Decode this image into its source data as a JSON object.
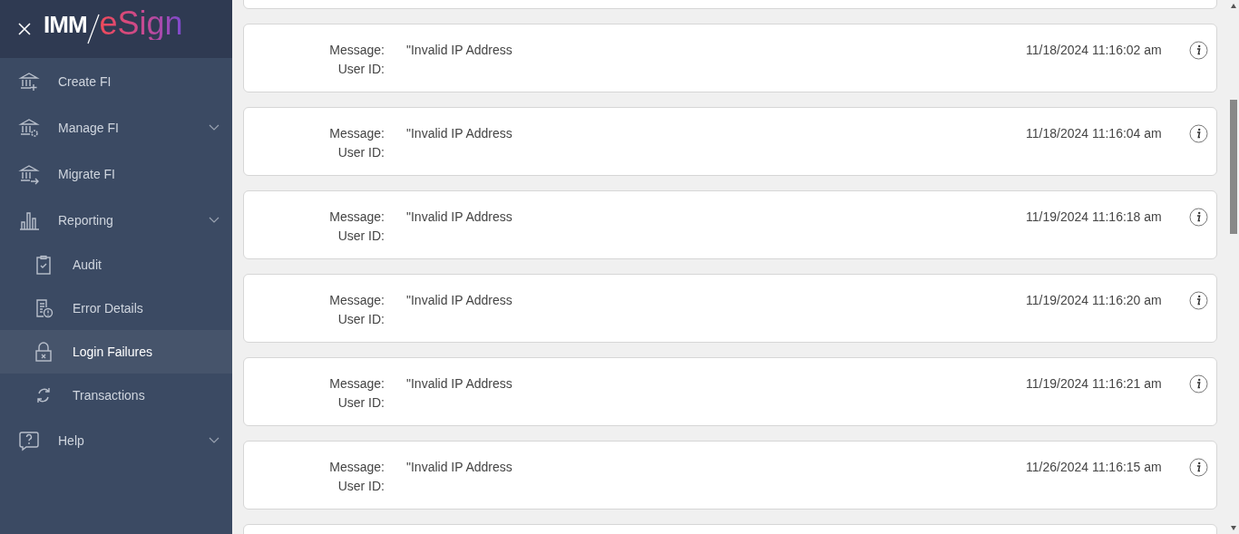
{
  "header": {
    "logo": {
      "part_1": "IMM",
      "part_2": "eSign"
    }
  },
  "sidebar": {
    "items": [
      {
        "label": "Create FI",
        "selected": false,
        "expandable": false
      },
      {
        "label": "Manage FI",
        "selected": false,
        "expandable": true
      },
      {
        "label": "Migrate FI",
        "selected": false,
        "expandable": false
      },
      {
        "label": "Reporting",
        "selected": false,
        "expandable": true,
        "children": [
          {
            "label": "Audit",
            "selected": false
          },
          {
            "label": "Error Details",
            "selected": false
          },
          {
            "label": "Login Failures",
            "selected": true
          },
          {
            "label": "Transactions",
            "selected": false
          }
        ]
      },
      {
        "label": "Help",
        "selected": false,
        "expandable": true
      }
    ]
  },
  "records": [
    {
      "message_label": "Message:",
      "message": "\"Invalid IP Address",
      "user_label": "User ID:",
      "timestamp": "11/18/2024 11:16:02 am"
    },
    {
      "message_label": "Message:",
      "message": "\"Invalid IP Address",
      "user_label": "User ID:",
      "timestamp": "11/18/2024 11:16:04 am"
    },
    {
      "message_label": "Message:",
      "message": "\"Invalid IP Address",
      "user_label": "User ID:",
      "timestamp": "11/19/2024 11:16:18 am"
    },
    {
      "message_label": "Message:",
      "message": "\"Invalid IP Address",
      "user_label": "User ID:",
      "timestamp": "11/19/2024 11:16:20 am"
    },
    {
      "message_label": "Message:",
      "message": "\"Invalid IP Address",
      "user_label": "User ID:",
      "timestamp": "11/19/2024 11:16:21 am"
    },
    {
      "message_label": "Message:",
      "message": "\"Invalid IP Address",
      "user_label": "User ID:",
      "timestamp": "11/26/2024 11:16:15 am"
    }
  ]
}
